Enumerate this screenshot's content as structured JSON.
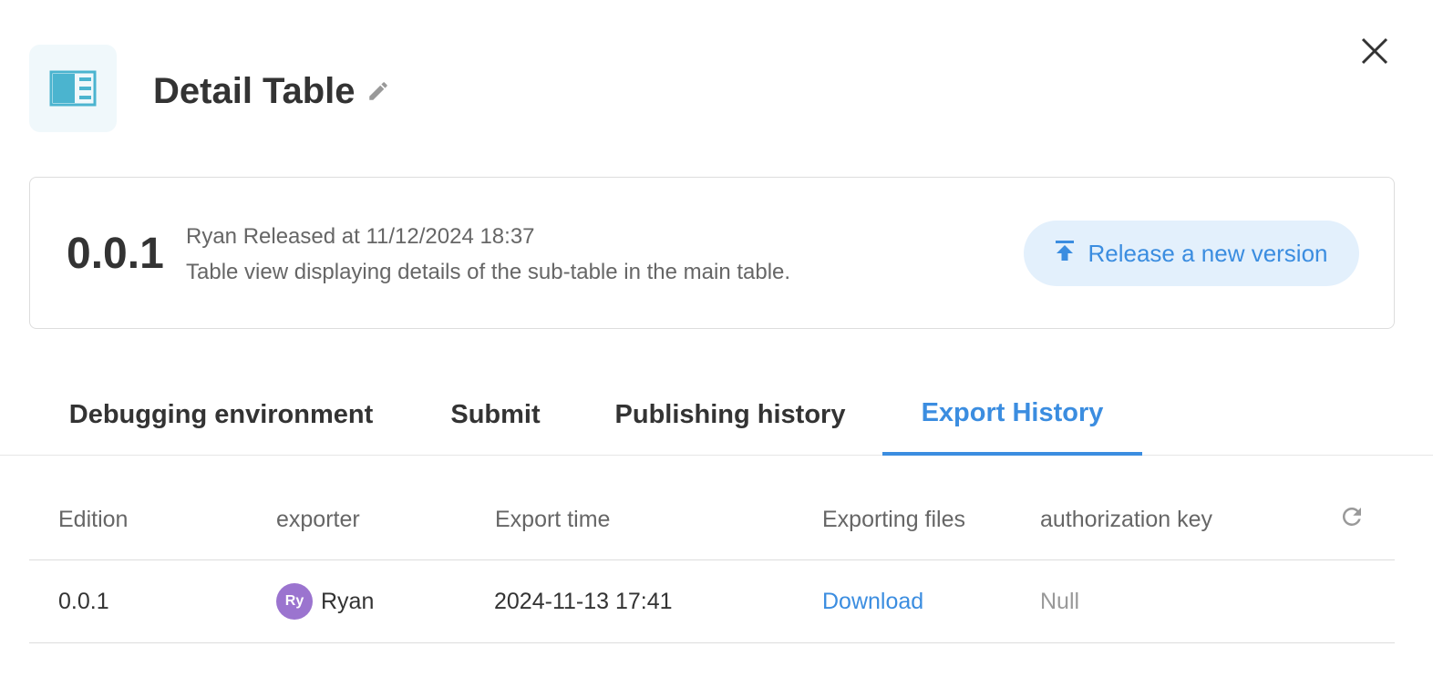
{
  "header": {
    "title": "Detail Table",
    "icon": "table-panel-icon",
    "accent_color": "#4bb4cf"
  },
  "version_card": {
    "version": "0.0.1",
    "release_meta": "Ryan Released at 11/12/2024 18:37",
    "description": "Table view displaying details of the sub-table in the main table.",
    "release_button_label": "Release a new version"
  },
  "tabs": [
    {
      "label": "Debugging environment",
      "active": false
    },
    {
      "label": "Submit",
      "active": false
    },
    {
      "label": "Publishing history",
      "active": false
    },
    {
      "label": "Export History",
      "active": true
    }
  ],
  "table": {
    "columns": [
      "Edition",
      "exporter",
      "Export time",
      "Exporting files",
      "authorization key"
    ],
    "rows": [
      {
        "edition": "0.0.1",
        "exporter_initials": "Ry",
        "exporter_name": "Ryan",
        "export_time": "2024-11-13 17:41",
        "file_link": "Download",
        "auth_key": "Null"
      }
    ]
  },
  "colors": {
    "primary": "#3b8de0",
    "primary_light": "#e3f0fc",
    "avatar": "#9b74cf"
  }
}
